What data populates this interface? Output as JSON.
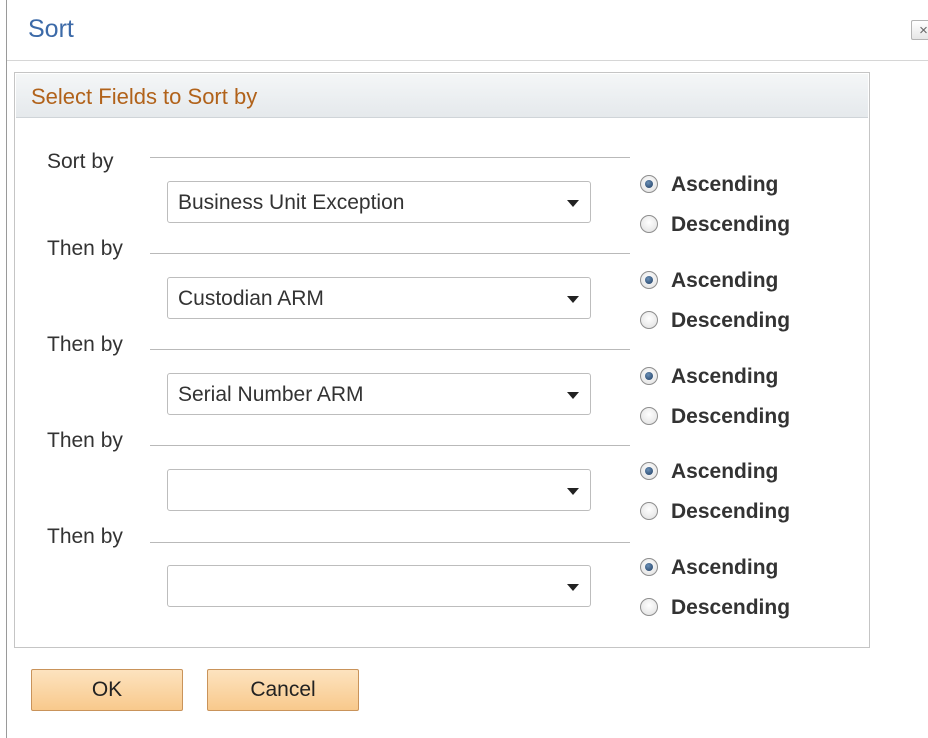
{
  "dialog": {
    "title": "Sort",
    "close_symbol": "×"
  },
  "group": {
    "title": "Select Fields to Sort by"
  },
  "sort_rows": [
    {
      "label": "Sort by",
      "field_value": "Business Unit Exception",
      "ascending_label": "Ascending",
      "descending_label": "Descending",
      "selected_order": "Ascending"
    },
    {
      "label": "Then by",
      "field_value": "Custodian ARM",
      "ascending_label": "Ascending",
      "descending_label": "Descending",
      "selected_order": "Ascending"
    },
    {
      "label": "Then by",
      "field_value": "Serial Number ARM",
      "ascending_label": "Ascending",
      "descending_label": "Descending",
      "selected_order": "Ascending"
    },
    {
      "label": "Then by",
      "field_value": "",
      "ascending_label": "Ascending",
      "descending_label": "Descending",
      "selected_order": "Ascending"
    },
    {
      "label": "Then by",
      "field_value": "",
      "ascending_label": "Ascending",
      "descending_label": "Descending",
      "selected_order": "Ascending"
    }
  ],
  "buttons": {
    "ok_label": "OK",
    "cancel_label": "Cancel"
  },
  "colors": {
    "title": "#3c6aa8",
    "group_title": "#b1621a",
    "button_fill": "#f8c98c",
    "button_border": "#c9935a"
  }
}
